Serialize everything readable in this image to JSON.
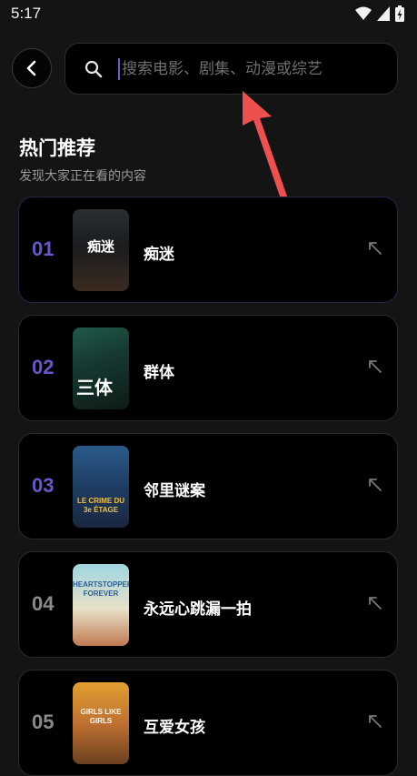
{
  "status_bar": {
    "time": "5:17"
  },
  "search": {
    "placeholder": "搜索电影、剧集、动漫或综艺",
    "value": ""
  },
  "section": {
    "title": "热门推荐",
    "subtitle": "发现大家正在看的内容"
  },
  "colors": {
    "accent": "#6d5bd0",
    "rank_top": "#6658c8",
    "rank_other": "#8a8a8a",
    "arrow": "#ee5050"
  },
  "items": [
    {
      "rank": "01",
      "title": "痴迷",
      "poster_text": "痴迷"
    },
    {
      "rank": "02",
      "title": "群体",
      "poster_text": "三体"
    },
    {
      "rank": "03",
      "title": "邻里谜案",
      "poster_text": "LE CRIME DU 3e ÉTAGE"
    },
    {
      "rank": "04",
      "title": "永远心跳漏一拍",
      "poster_text": "HEARTSTOPPER FOREVER"
    },
    {
      "rank": "05",
      "title": "互爱女孩",
      "poster_text": "GIRLS LIKE GIRLS"
    }
  ]
}
